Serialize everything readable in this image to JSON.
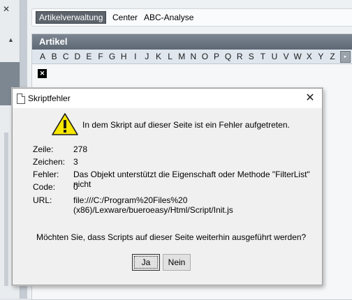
{
  "app": {
    "menu": [
      "Artikelverwaltung",
      "Center",
      "ABC-Analyse"
    ],
    "panel_title": "Artikel",
    "alphabet": [
      "A",
      "B",
      "C",
      "D",
      "E",
      "F",
      "G",
      "H",
      "I",
      "J",
      "K",
      "L",
      "M",
      "N",
      "O",
      "P",
      "Q",
      "R",
      "S",
      "T",
      "U",
      "V",
      "W",
      "X",
      "Y",
      "Z"
    ]
  },
  "dialog": {
    "title": "Skriptfehler",
    "message": "In dem Skript auf dieser Seite ist ein Fehler aufgetreten.",
    "fields": [
      {
        "label": "Zeile:",
        "value": "278"
      },
      {
        "label": "Zeichen:",
        "value": "3"
      },
      {
        "label": "Fehler:",
        "value": "Das Objekt unterstützt die Eigenschaft oder Methode \"FilterList\" nicht"
      },
      {
        "label": "Code:",
        "value": "0"
      },
      {
        "label": "URL:",
        "value": "file:///C:/Program%20Files%20"
      },
      {
        "label": "",
        "value": "(x86)/Lexware/bueroeasy/Html/Script/Init.js"
      }
    ],
    "question": "Möchten Sie, dass Scripts auf dieser Seite weiterhin ausgeführt werden?",
    "yes_label": "Ja",
    "no_label": "Nein"
  }
}
